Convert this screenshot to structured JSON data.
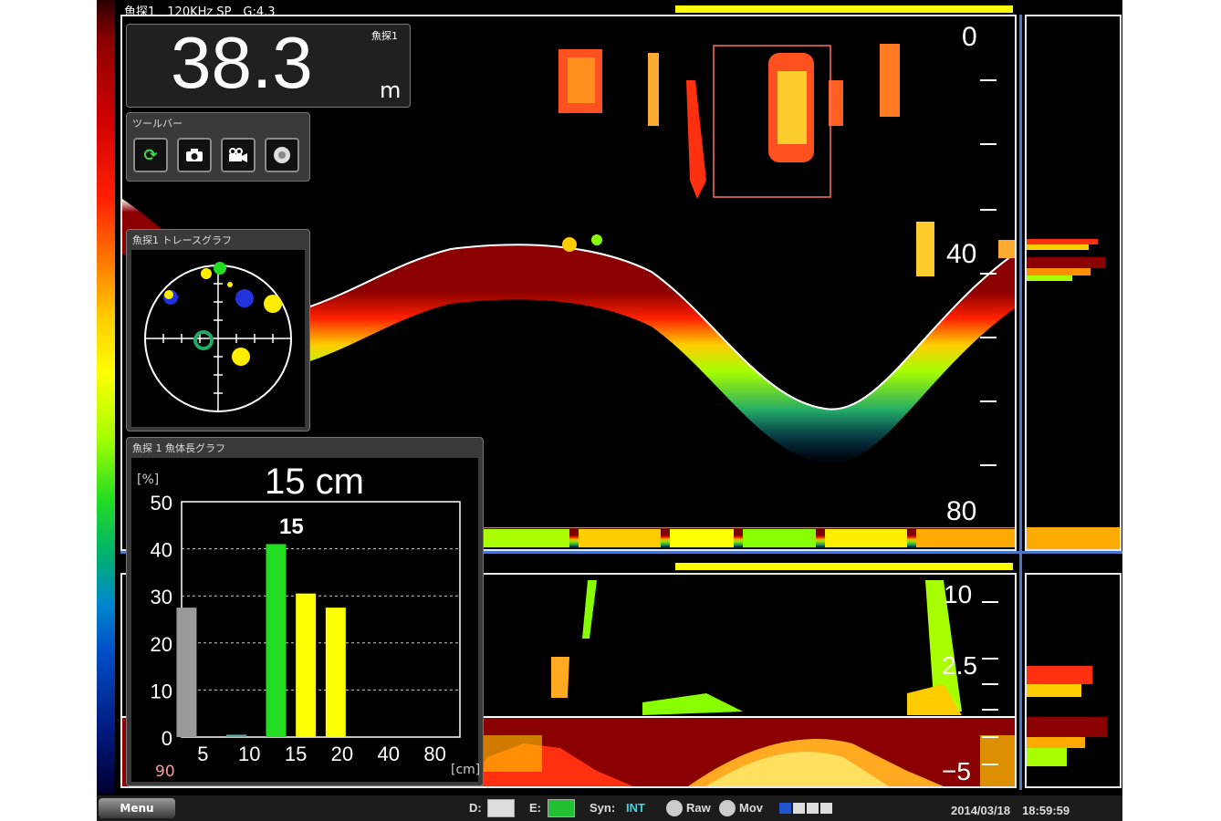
{
  "header": {
    "info": "魚探1　120KHz SP　G:4.3"
  },
  "depth_readout": {
    "value": "38.3",
    "unit": "m",
    "label": "魚探1"
  },
  "toolbar": {
    "title": "ツールバー",
    "buttons": [
      {
        "name": "refresh-icon",
        "glyph": "⟳",
        "color": "#3fd64a"
      },
      {
        "name": "camera-icon",
        "glyph": "📷",
        "color": "#fff"
      },
      {
        "name": "video-icon",
        "glyph": "📹",
        "color": "#fff"
      },
      {
        "name": "record-icon",
        "glyph": "●",
        "color": "#fff"
      }
    ]
  },
  "trace_graph": {
    "title": "魚探1 トレースグラフ"
  },
  "length_graph": {
    "title": "魚探 1 魚体長グラフ",
    "headline": "15 cm",
    "peak_label": "15",
    "yunit": "[%]",
    "xunit": "[cm]",
    "footer": "90"
  },
  "upper_scale": {
    "top": "0",
    "mid": "40",
    "bottom": "80"
  },
  "lower_scale": {
    "top": "10",
    "mid": "2.5",
    "bottom": "−5"
  },
  "status": {
    "menu": "Menu",
    "d_label": "D:",
    "e_label": "E:",
    "syn_label": "Syn:",
    "syn_value": "INT",
    "raw": "Raw",
    "mov": "Mov",
    "datetime": "2014/03/18　18:59:59"
  },
  "colors": {
    "accent_yellow": "#ffff00",
    "panel_border": "#4a78c8",
    "bar_gray": "#9a9a9a",
    "bar_green": "#22dd22",
    "bar_yellow": "#ffff00"
  },
  "chart_data": {
    "type": "bar",
    "categories": [
      "5",
      "10",
      "15",
      "20",
      "40",
      "80"
    ],
    "ytick_labels": [
      "0",
      "10",
      "20",
      "30",
      "40",
      "50"
    ],
    "ylim": [
      0,
      50
    ],
    "bars": [
      {
        "x": 4.5,
        "value": 27.5,
        "color": "#9a9a9a"
      },
      {
        "x": 9.5,
        "value": 0.5,
        "color": "#6aa"
      },
      {
        "x": 13.5,
        "value": 41,
        "color": "#22dd22"
      },
      {
        "x": 16.5,
        "value": 30.5,
        "color": "#ffff00"
      },
      {
        "x": 19.5,
        "value": 27.5,
        "color": "#ffff00"
      }
    ]
  }
}
